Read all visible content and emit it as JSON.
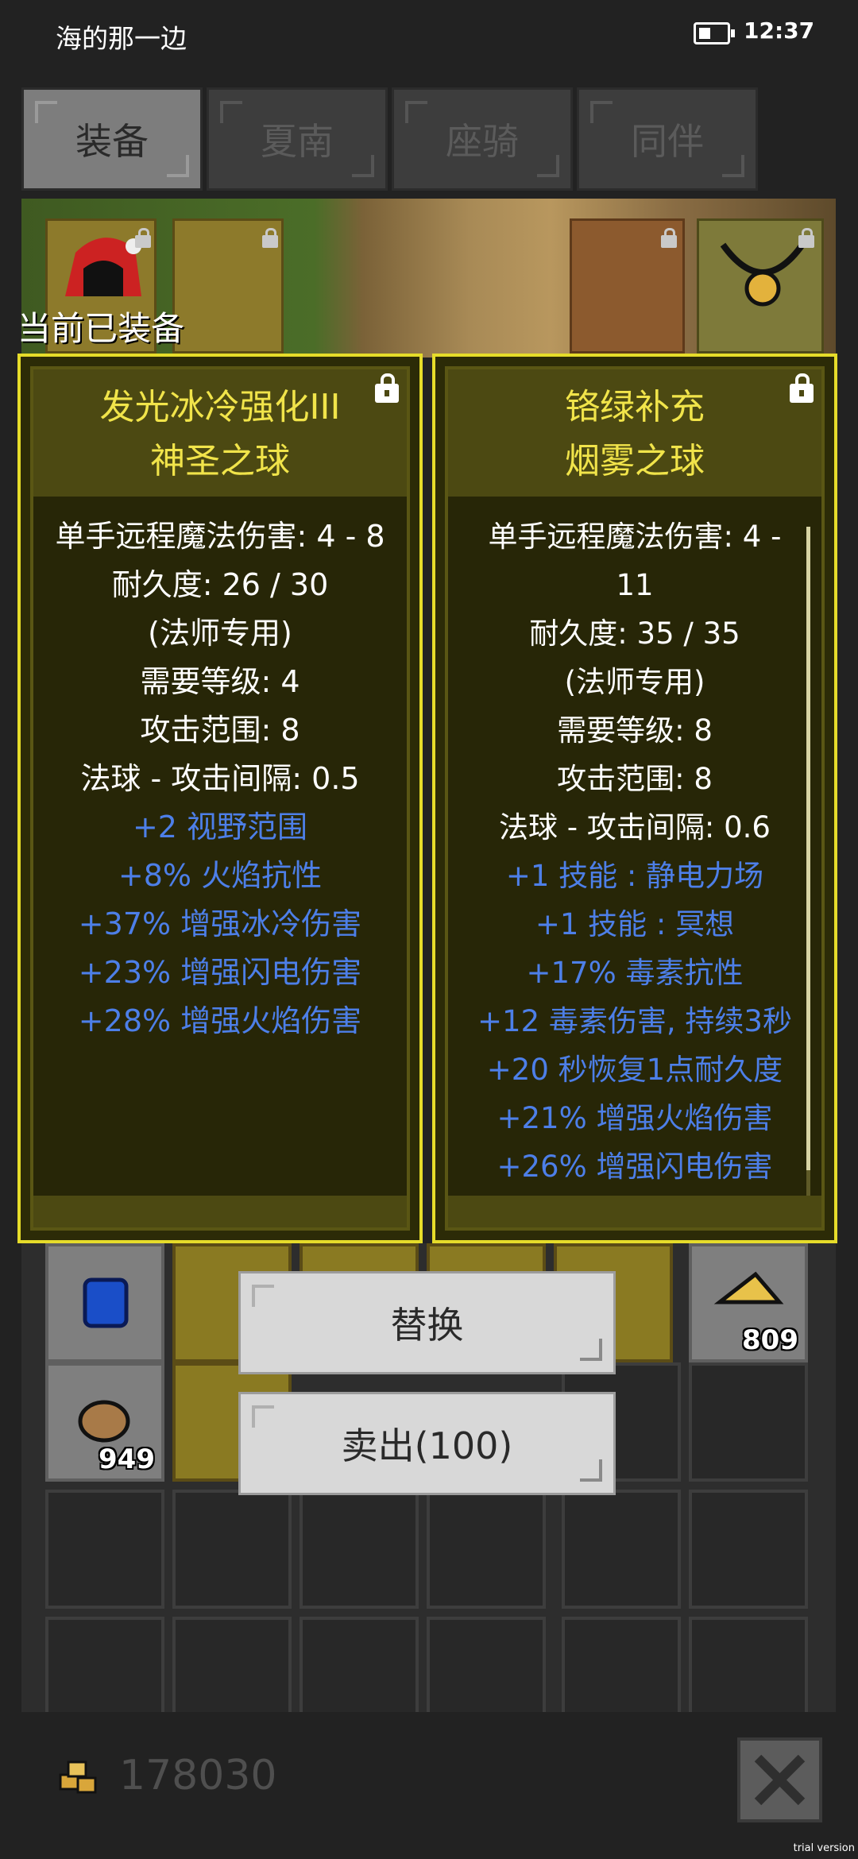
{
  "status_bar": {
    "title": "海的那一边",
    "time": "12:37"
  },
  "tabs": [
    {
      "label": "装备",
      "active": true
    },
    {
      "label": "夏南",
      "active": false
    },
    {
      "label": "座骑",
      "active": false
    },
    {
      "label": "同伴",
      "active": false
    }
  ],
  "current_equipped_label": "当前已装备",
  "cards": {
    "left": {
      "name_line1": "发光冰冷强化III",
      "name_line2": "神圣之球",
      "stats": [
        "单手远程魔法伤害: 4 - 8",
        "耐久度: 26 / 30",
        "(法师专用)",
        "需要等级: 4",
        "攻击范围: 8",
        "法球 - 攻击间隔: 0.5"
      ],
      "bonuses": [
        "+2 视野范围",
        "+8% 火焰抗性",
        "+37% 增强冰冷伤害",
        "+23% 增强闪电伤害",
        "+28% 增强火焰伤害"
      ]
    },
    "right": {
      "name_line1": "铬绿补充",
      "name_line2": "烟雾之球",
      "stats": [
        "单手远程魔法伤害: 4 -",
        "11",
        "耐久度: 35 / 35",
        "(法师专用)",
        "需要等级: 8",
        "攻击范围: 8",
        "法球 - 攻击间隔: 0.6"
      ],
      "bonuses": [
        "+1 技能 : 静电力场",
        "+1 技能 : 冥想",
        "+17% 毒素抗性",
        "+12 毒素伤害, 持续3秒",
        "+20 秒恢复1点耐久度",
        "+21% 增强火焰伤害",
        "+26% 增强闪电伤害"
      ]
    }
  },
  "inventory": {
    "count_cheese": "809",
    "count_bread": "949"
  },
  "actions": {
    "replace": "替换",
    "sell": "卖出(100)"
  },
  "gold": "178030",
  "watermark": "trial version",
  "colors": {
    "card_border": "#e6dc2a",
    "item_name": "#f1e44a",
    "bonus_text": "#4d7fe8"
  },
  "icons": [
    "battery-icon",
    "lock-icon",
    "gold-coins-icon",
    "close-icon"
  ]
}
